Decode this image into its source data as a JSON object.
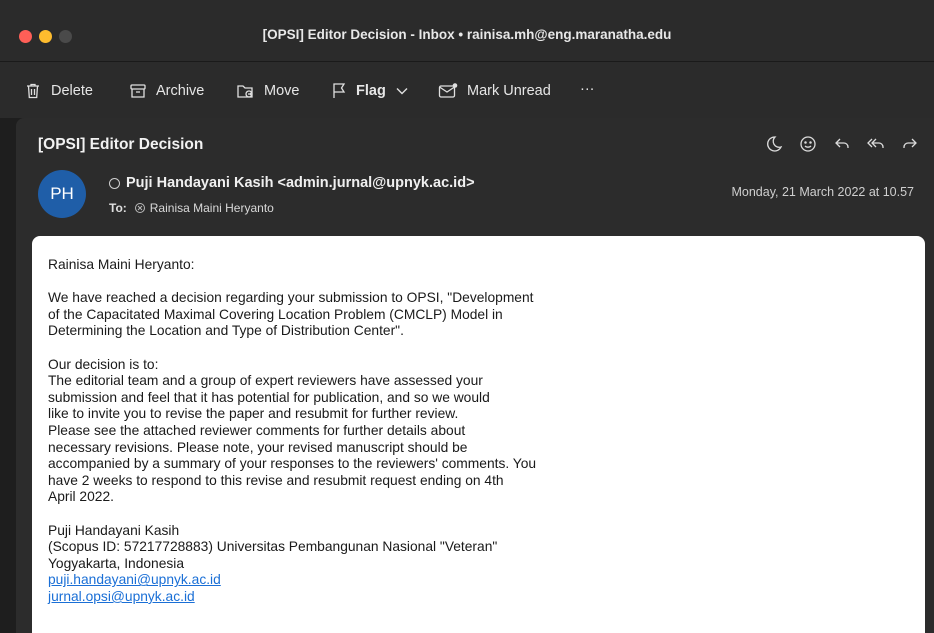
{
  "window": {
    "title": "[OPSI] Editor Decision - Inbox • rainisa.mh@eng.maranatha.edu"
  },
  "toolbar": {
    "delete_label": "Delete",
    "archive_label": "Archive",
    "move_label": "Move",
    "flag_label": "Flag",
    "mark_unread_label": "Mark Unread",
    "more_label": "···"
  },
  "message": {
    "subject": "[OPSI] Editor Decision",
    "avatar_initials": "PH",
    "avatar_color": "#1f5ea8",
    "sender": "Puji Handayani Kasih <admin.jurnal@upnyk.ac.id>",
    "to_label": "To:",
    "recipient": "Rainisa Maini Heryanto",
    "date": "Monday, 21 March 2022 at 10.57"
  },
  "body": {
    "greeting": "Rainisa Maini Heryanto:",
    "para1": [
      "We have reached a decision regarding your submission to OPSI, \"Development",
      "of the Capacitated Maximal Covering Location Problem (CMCLP) Model in",
      "Determining the Location and Type of Distribution Center\"."
    ],
    "para2": [
      "Our decision is to:",
      "The editorial team and a group of expert reviewers have assessed your",
      "submission and feel that it has potential for publication, and so we would",
      "like to invite you to revise the paper and resubmit for further review.",
      "Please see the attached reviewer comments for further details about",
      "necessary revisions. Please note, your revised manuscript should be",
      "accompanied by a summary of your responses to the reviewers' comments. You",
      "have 2 weeks to respond to this revise and resubmit request ending on 4th",
      "April 2022."
    ],
    "signature": [
      "Puji Handayani Kasih",
      "(Scopus ID: 57217728883) Universitas Pembangunan Nasional \"Veteran\"",
      "Yogyakarta, Indonesia"
    ],
    "link1": "puji.handayani@upnyk.ac.id",
    "link2": "jurnal.opsi@upnyk.ac.id"
  },
  "icons": {
    "actions": [
      "moon-icon",
      "emoji-icon",
      "reply-icon",
      "reply-all-icon",
      "forward-icon"
    ]
  }
}
